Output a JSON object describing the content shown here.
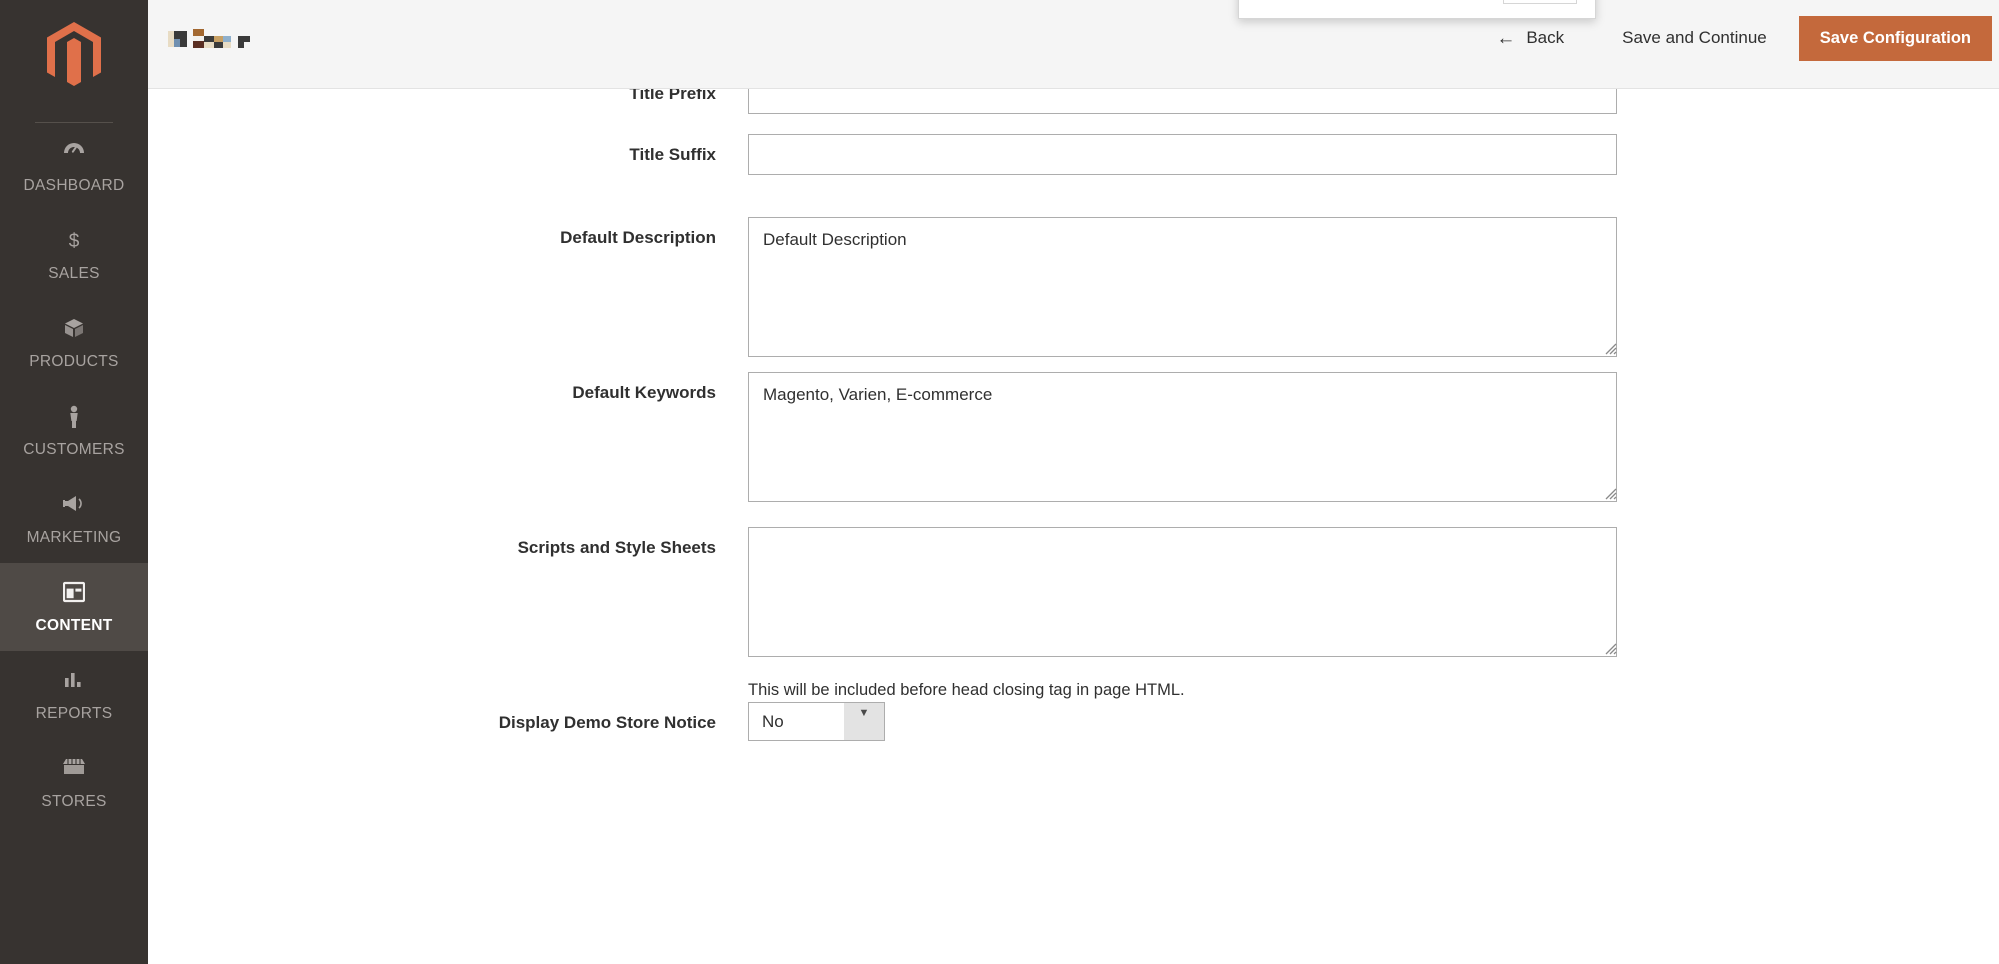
{
  "sidebar": {
    "logo_name": "magento-logo",
    "items": [
      {
        "label": "DASHBOARD",
        "icon": "dashboard-gauge-icon",
        "active": false
      },
      {
        "label": "SALES",
        "icon": "dollar-sign-icon",
        "active": false
      },
      {
        "label": "PRODUCTS",
        "icon": "box-icon",
        "active": false
      },
      {
        "label": "CUSTOMERS",
        "icon": "person-icon",
        "active": false
      },
      {
        "label": "MARKETING",
        "icon": "megaphone-icon",
        "active": false
      },
      {
        "label": "CONTENT",
        "icon": "layout-window-icon",
        "active": true
      },
      {
        "label": "REPORTS",
        "icon": "bar-chart-icon",
        "active": false
      },
      {
        "label": "STORES",
        "icon": "storefront-icon",
        "active": false
      }
    ]
  },
  "header": {
    "title_redacted": true,
    "back_label": "Back",
    "back_icon": "arrow-left-icon",
    "save_continue_label": "Save and Continue",
    "save_config_label": "Save Configuration",
    "primary_color": "#c4693c"
  },
  "form": {
    "fields": [
      {
        "label": "Title Prefix",
        "type": "text",
        "value": "",
        "note": ""
      },
      {
        "label": "Title Suffix",
        "type": "text",
        "value": "",
        "note": ""
      },
      {
        "label": "Default Description",
        "type": "textarea",
        "value": "Default Description",
        "note": ""
      },
      {
        "label": "Default Keywords",
        "type": "textarea",
        "value": "Magento, Varien, E-commerce",
        "note": ""
      },
      {
        "label": "Scripts and Style Sheets",
        "type": "textarea",
        "value": "",
        "note": "This will be included before head closing tag in page HTML."
      },
      {
        "label": "Display Demo Store Notice",
        "type": "select",
        "value": "No",
        "note": ""
      }
    ]
  }
}
